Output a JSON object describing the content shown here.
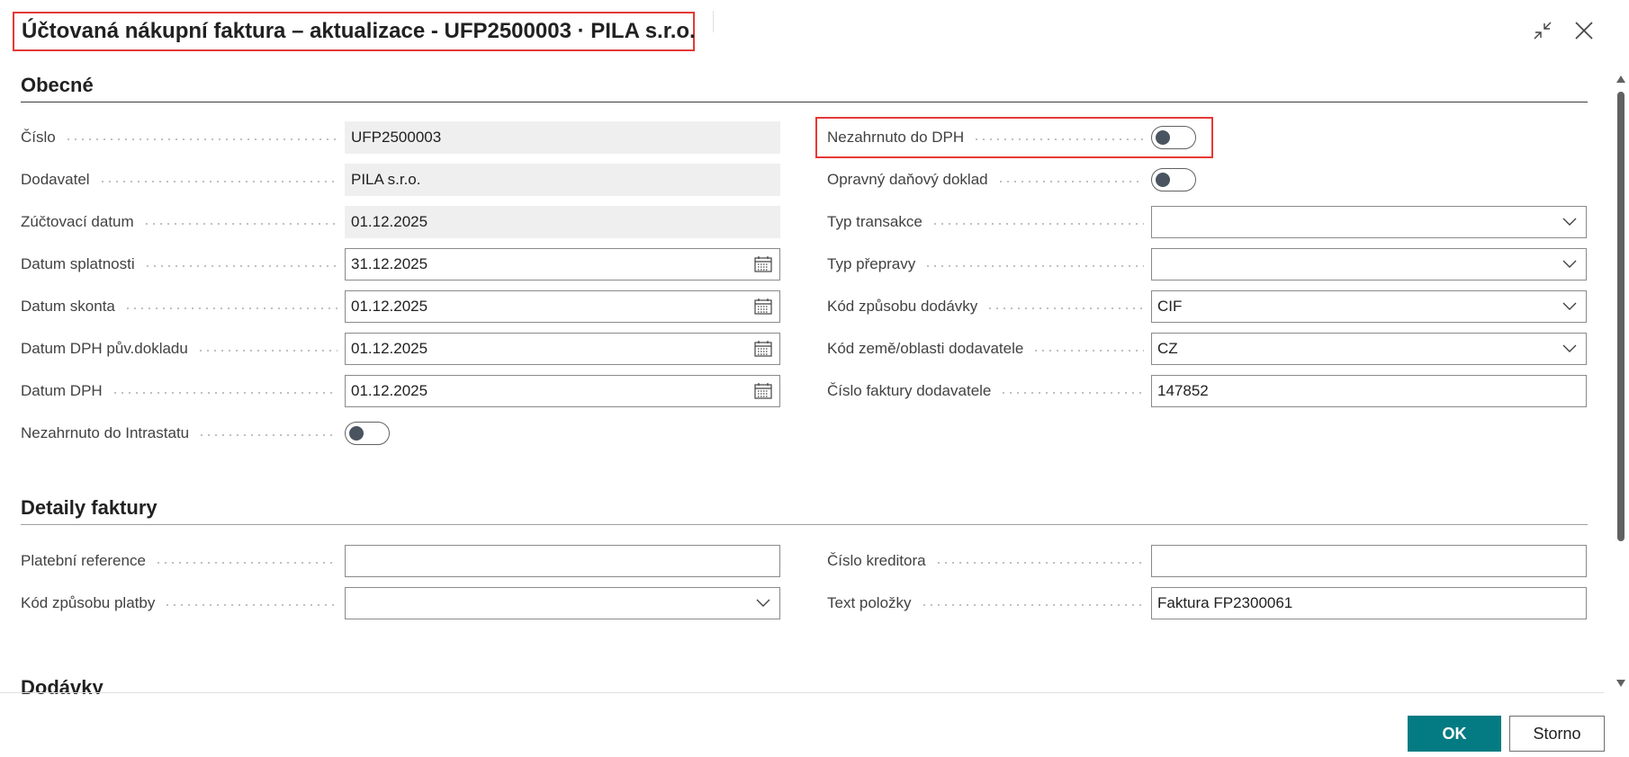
{
  "window": {
    "title": "Účtovaná nákupní faktura – aktualizace - UFP2500003 · PILA s.r.o.",
    "collapse_icon": "collapse-icon",
    "close_icon": "close-icon"
  },
  "sections": {
    "general": {
      "title": "Obecné",
      "left": [
        {
          "label": "Číslo",
          "value": "UFP2500003",
          "kind": "readonly"
        },
        {
          "label": "Dodavatel",
          "value": "PILA s.r.o.",
          "kind": "readonly"
        },
        {
          "label": "Zúčtovací datum",
          "value": "01.12.2025",
          "kind": "readonly"
        },
        {
          "label": "Datum splatnosti",
          "value": "31.12.2025",
          "kind": "date"
        },
        {
          "label": "Datum skonta",
          "value": "01.12.2025",
          "kind": "date"
        },
        {
          "label": "Datum DPH pův.dokladu",
          "value": "01.12.2025",
          "kind": "date"
        },
        {
          "label": "Datum DPH",
          "value": "01.12.2025",
          "kind": "date"
        },
        {
          "label": "Nezahrnuto do Intrastatu",
          "value": false,
          "kind": "toggle"
        }
      ],
      "right": [
        {
          "label": "Nezahrnuto do DPH",
          "value": false,
          "kind": "toggle"
        },
        {
          "label": "Opravný daňový doklad",
          "value": false,
          "kind": "toggle"
        },
        {
          "label": "Typ transakce",
          "value": "",
          "kind": "select"
        },
        {
          "label": "Typ přepravy",
          "value": "",
          "kind": "select"
        },
        {
          "label": "Kód způsobu dodávky",
          "value": "CIF",
          "kind": "select"
        },
        {
          "label": "Kód země/oblasti dodavatele",
          "value": "CZ",
          "kind": "select"
        },
        {
          "label": "Číslo faktury dodavatele",
          "value": "147852",
          "kind": "text"
        }
      ]
    },
    "invoice_details": {
      "title": "Detaily faktury",
      "left": [
        {
          "label": "Platební reference",
          "value": "",
          "kind": "text"
        },
        {
          "label": "Kód způsobu platby",
          "value": "",
          "kind": "select"
        }
      ],
      "right": [
        {
          "label": "Číslo kreditora",
          "value": "",
          "kind": "text"
        },
        {
          "label": "Text položky",
          "value": "Faktura FP2300061",
          "kind": "text"
        }
      ]
    },
    "deliveries": {
      "title": "Dodávky"
    }
  },
  "buttons": {
    "ok": "OK",
    "cancel": "Storno"
  },
  "colors": {
    "accent": "#047b82",
    "highlight": "#e53935",
    "readonly_bg": "#efefef"
  }
}
